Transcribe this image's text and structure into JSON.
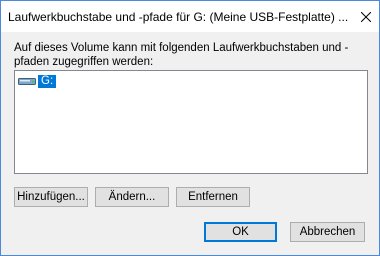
{
  "window": {
    "title": "Laufwerkbuchstabe und -pfade für G: (Meine USB-Festplatte) ..."
  },
  "dialog": {
    "description": "Auf dieses Volume kann mit folgenden Laufwerkbuchstaben und -pfaden zugegriffen werden:",
    "list": {
      "items": [
        {
          "label": "G:",
          "icon": "drive-icon",
          "selected": true
        }
      ]
    },
    "buttons": {
      "add": "Hinzufügen...",
      "change": "Ändern...",
      "remove": "Entfernen",
      "ok": "OK",
      "cancel": "Abbrechen"
    }
  },
  "colors": {
    "selection": "#0078d7",
    "window_border": "#4a8ad8",
    "dialog_background": "#f0f0f0"
  }
}
